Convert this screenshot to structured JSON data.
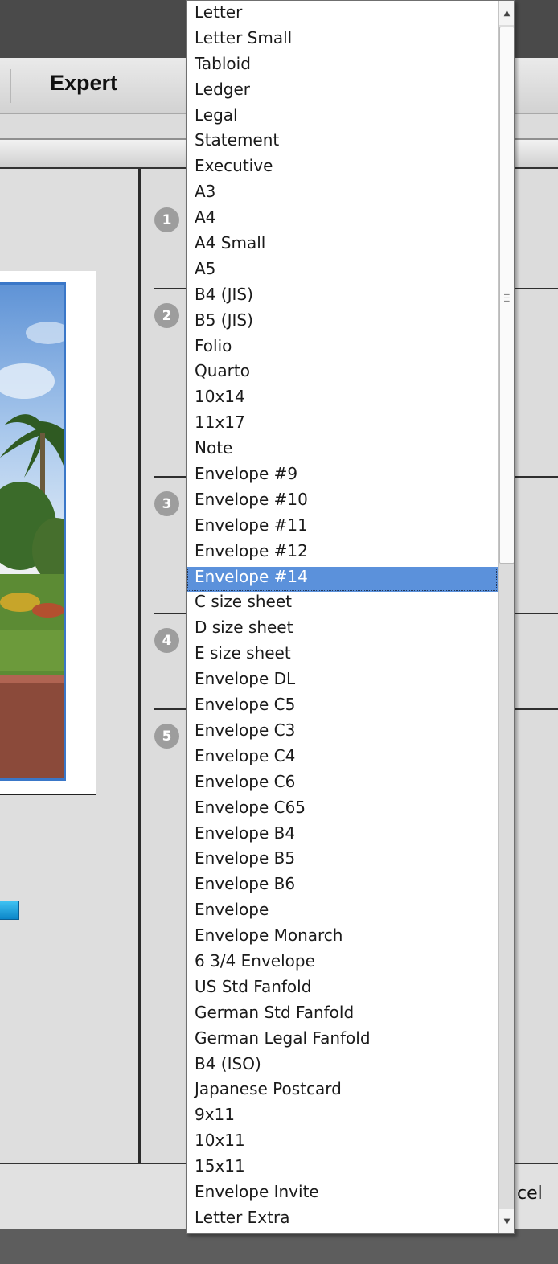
{
  "tabs": {
    "expert_label": "Expert"
  },
  "steps": [
    "1",
    "2",
    "3",
    "4",
    "5"
  ],
  "bottom_bar": {
    "cancel_fragment": "cel"
  },
  "dropdown": {
    "selected": "Envelope #14",
    "items": [
      "Letter",
      "Letter Small",
      "Tabloid",
      "Ledger",
      "Legal",
      "Statement",
      "Executive",
      "A3",
      "A4",
      "A4 Small",
      "A5",
      "B4 (JIS)",
      "B5 (JIS)",
      "Folio",
      "Quarto",
      "10x14",
      "11x17",
      "Note",
      "Envelope #9",
      "Envelope #10",
      "Envelope #11",
      "Envelope #12",
      "Envelope #14",
      "C size sheet",
      "D size sheet",
      "E size sheet",
      "Envelope DL",
      "Envelope C5",
      "Envelope C3",
      "Envelope C4",
      "Envelope C6",
      "Envelope C65",
      "Envelope B4",
      "Envelope B5",
      "Envelope B6",
      "Envelope",
      "Envelope Monarch",
      "6 3/4 Envelope",
      "US Std Fanfold",
      "German Std Fanfold",
      "German Legal Fanfold",
      "B4 (ISO)",
      "Japanese Postcard",
      "9x11",
      "10x11",
      "15x11",
      "Envelope Invite",
      "Letter Extra"
    ]
  },
  "colors": {
    "selection": "#5b91db",
    "photo_border": "#3a77c8",
    "slider": "#1aa3e0"
  },
  "icons": {
    "scroll_up": "up-arrow-icon",
    "scroll_down": "down-arrow-icon",
    "grip": "scroll-grip-icon"
  }
}
